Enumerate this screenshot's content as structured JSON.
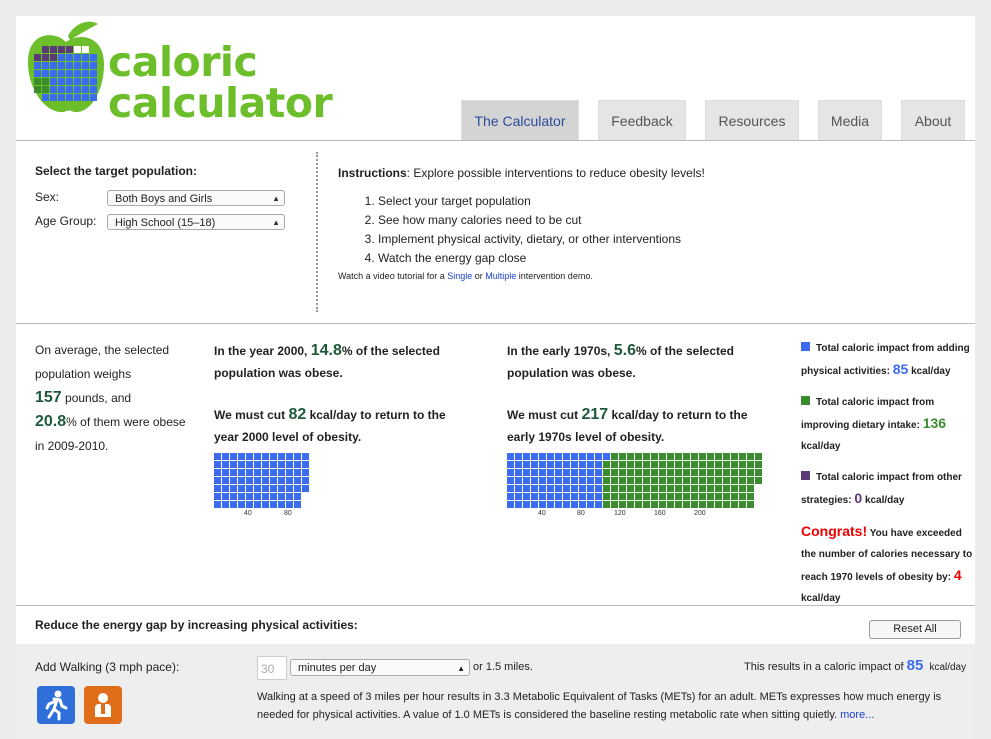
{
  "logo": {
    "line1": "caloric",
    "line2": "calculator"
  },
  "tabs": [
    {
      "label": "The Calculator",
      "active": true
    },
    {
      "label": "Feedback",
      "active": false
    },
    {
      "label": "Resources",
      "active": false
    },
    {
      "label": "Media",
      "active": false
    },
    {
      "label": "About",
      "active": false
    }
  ],
  "population": {
    "title": "Select the target population:",
    "sex_label": "Sex:",
    "sex_value": "Both Boys and Girls",
    "age_label": "Age Group:",
    "age_value": "High School (15–18)"
  },
  "instructions": {
    "bold": "Instructions",
    "text": ": Explore possible interventions to reduce obesity levels!",
    "steps": [
      "Select your target population",
      "See how many calories need to be cut",
      "Implement physical activity, dietary, or other interventions",
      "Watch the energy gap close"
    ],
    "video_pre": "Watch a video tutorial for a ",
    "video_single": "Single",
    "video_or": " or ",
    "video_multiple": "Multiple",
    "video_post": " intervention demo."
  },
  "average": {
    "t1": "On average, the selected population weighs",
    "pounds": "157",
    "t2": " pounds, and",
    "pct": "20.8",
    "t3": "% of them were obese in 2009-2010."
  },
  "y2000": {
    "t1": "In the year 2000, ",
    "pct": "14.8",
    "t2": "% of the selected population was obese.",
    "t3": "We must cut ",
    "kcal": "82",
    "t4": " kcal/day to return to the year 2000 level of obesity.",
    "ticks": [
      "40",
      "80"
    ]
  },
  "y1970": {
    "t1": "In the early 1970s, ",
    "pct": "5.6",
    "t2": "% of the selected population was obese.",
    "t3": "We must cut ",
    "kcal": "217",
    "t4": " kcal/day to return to the early 1970s level of obesity.",
    "ticks": [
      "40",
      "80",
      "120",
      "160",
      "200"
    ]
  },
  "waffle_2000": {
    "blue": 82
  },
  "waffle_1970": {
    "blue": 85,
    "green": 136
  },
  "legend": {
    "phys_text": "Total caloric impact from adding physical activities: ",
    "phys_val": "85",
    "diet_text": "Total caloric impact from improving dietary intake: ",
    "diet_val": "136",
    "other_text": "Total caloric impact from other strategies: ",
    "other_val": "0",
    "unit": "kcal/day",
    "congrats": "Congrats!",
    "congrats_text": " You have exceeded the number of calories necessary to reach 1970 levels of obesity by: ",
    "congrats_val": "4"
  },
  "colors": {
    "blue": "#3b6cf0",
    "green": "#3a8c2e",
    "purple": "#5b3a7a",
    "red": "#e00000",
    "logo_green": "#6cbf2a"
  },
  "physical": {
    "heading": "Reduce the energy gap by increasing physical activities:",
    "reset": "Reset All",
    "walk_label": "Add Walking (3 mph pace):",
    "minutes_value": "30",
    "unit_select": "minutes per day",
    "miles": "or 1.5 miles.",
    "result_pre": "This results in a caloric impact of ",
    "result_val": "85",
    "result_unit": "kcal/day",
    "desc": "Walking at a speed of 3 miles per hour results in 3.3 Metabolic Equivalent of Tasks (METs) for an adult. METs expresses how much energy is needed for physical activities. A value of 1.0 METs is considered the baseline resting metabolic rate when sitting quietly. ",
    "more": "more..."
  }
}
